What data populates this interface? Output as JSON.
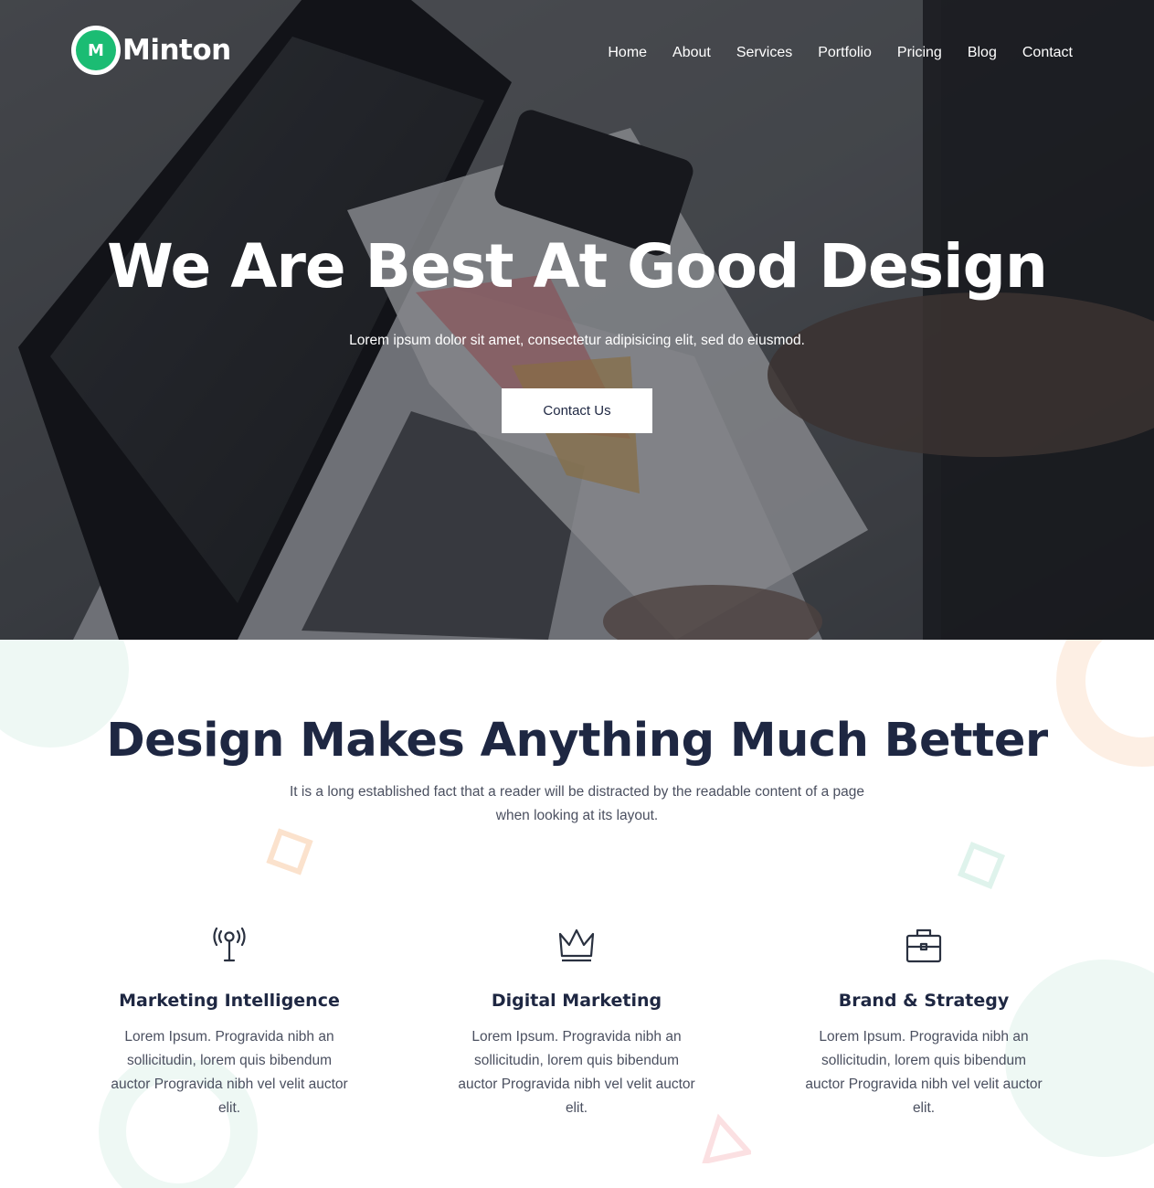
{
  "brand": {
    "logo_letter": "M",
    "name": "Minton",
    "accent": "#1bbc73"
  },
  "nav": {
    "items": [
      {
        "label": "Home"
      },
      {
        "label": "About"
      },
      {
        "label": "Services"
      },
      {
        "label": "Portfolio"
      },
      {
        "label": "Pricing"
      },
      {
        "label": "Blog"
      },
      {
        "label": "Contact"
      }
    ]
  },
  "hero": {
    "title": "We Are Best At Good Design",
    "subtitle": "Lorem ipsum dolor sit amet, consectetur adipisicing elit, sed do eiusmod.",
    "cta_label": "Contact Us"
  },
  "intro": {
    "title": "Design Makes Anything Much Better",
    "description": "It is a long established fact that a reader will be distracted by the readable content of a page when looking at its layout."
  },
  "features": [
    {
      "icon": "antenna-icon",
      "title": "Marketing Intelligence",
      "text": "Lorem Ipsum. Progravida nibh an sollicitudin, lorem quis bibendum auctor Progravida nibh vel velit auctor elit."
    },
    {
      "icon": "crown-icon",
      "title": "Digital Marketing",
      "text": "Lorem Ipsum. Progravida nibh an sollicitudin, lorem quis bibendum auctor Progravida nibh vel velit auctor elit."
    },
    {
      "icon": "briefcase-icon",
      "title": "Brand & Strategy",
      "text": "Lorem Ipsum. Progravida nibh an sollicitudin, lorem quis bibendum auctor Progravida nibh vel velit auctor elit."
    }
  ],
  "colors": {
    "heading": "#1e2742",
    "body_text": "#4b5060",
    "deco_mint": "#e6f6f0",
    "deco_peach": "#fdeee3",
    "deco_pink": "#fbe3e5"
  }
}
